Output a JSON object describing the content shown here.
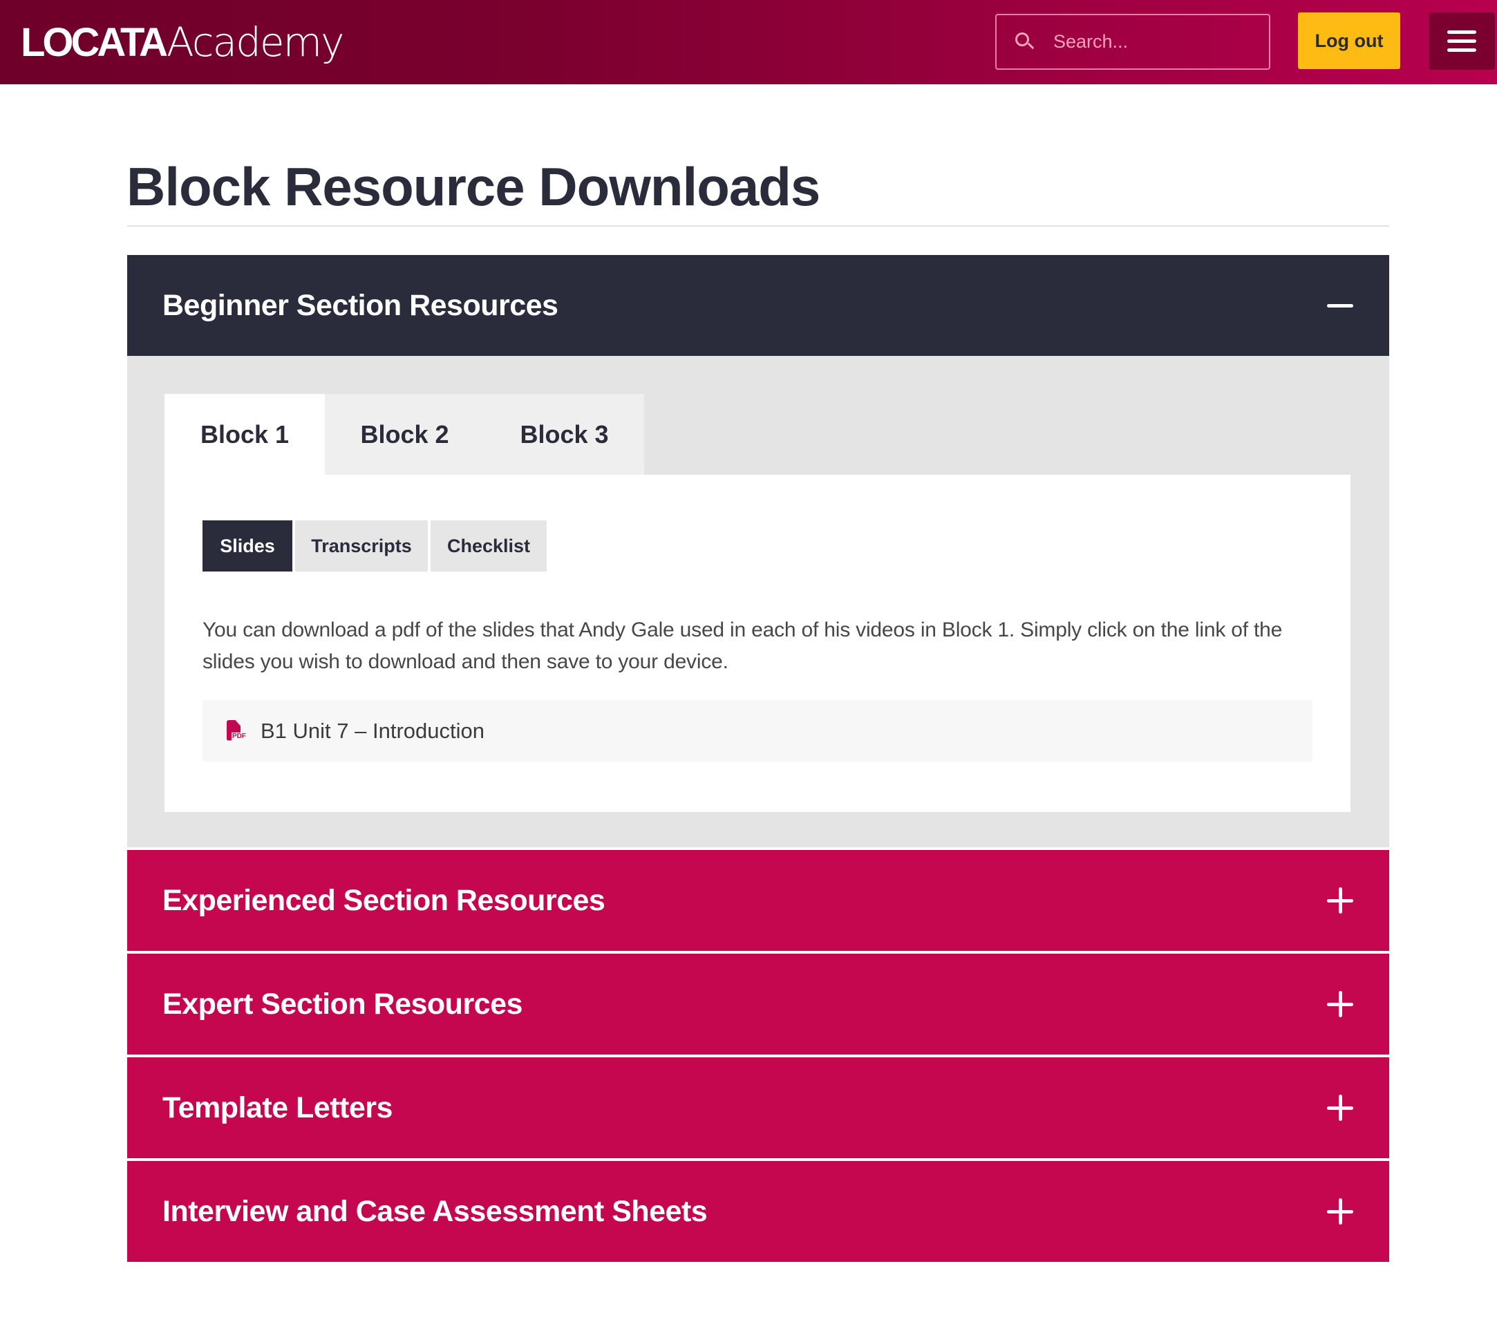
{
  "header": {
    "logo_bold": "LOCATA",
    "logo_light": "Academy",
    "search_placeholder": "Search...",
    "logout_label": "Log out",
    "menu_icon": "hamburger-icon",
    "search_icon": "search-icon"
  },
  "page": {
    "title": "Block Resource Downloads"
  },
  "colors": {
    "brand_dark": "#2b2c3b",
    "brand_pink": "#c4074f",
    "header_gradient_start": "#6e0029",
    "header_gradient_end": "#b8004f",
    "logout_yellow": "#fdbb14"
  },
  "accordion": {
    "open_section": {
      "title": "Beginner Section Resources",
      "toggle_icon": "minus-icon",
      "block_tabs": [
        {
          "label": "Block 1",
          "active": true
        },
        {
          "label": "Block 2",
          "active": false
        },
        {
          "label": "Block 3",
          "active": false
        }
      ],
      "sub_tabs": [
        {
          "label": "Slides",
          "active": true
        },
        {
          "label": "Transcripts",
          "active": false
        },
        {
          "label": "Checklist",
          "active": false
        }
      ],
      "description": "You can download a pdf of the slides that Andy Gale used in each of his videos in Block 1. Simply click on the link of the slides you wish to download and then save to your device.",
      "downloads": [
        {
          "label": "B1 Unit 7 – Introduction",
          "icon": "pdf-file-icon",
          "icon_text": "PDF"
        }
      ]
    },
    "closed_sections": [
      {
        "title": "Experienced Section Resources",
        "toggle_icon": "plus-icon"
      },
      {
        "title": "Expert Section Resources",
        "toggle_icon": "plus-icon"
      },
      {
        "title": "Template Letters",
        "toggle_icon": "plus-icon"
      },
      {
        "title": "Interview and Case Assessment Sheets",
        "toggle_icon": "plus-icon"
      }
    ]
  }
}
